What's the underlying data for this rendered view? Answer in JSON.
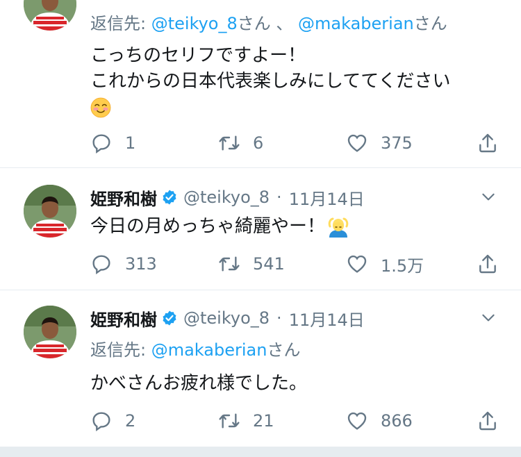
{
  "tweets": [
    {
      "reply_prefix": "返信先: ",
      "mentions": [
        "@teikyo_8",
        "@makaberian"
      ],
      "san": "さん",
      "sep": " 、 ",
      "line1": "こっちのセリフですよー！",
      "line2": "これからの日本代表楽しみにしててください",
      "replies": "1",
      "retweets": "6",
      "likes": "375"
    },
    {
      "name": "姫野和樹",
      "handle": "@teikyo_8",
      "dot": "·",
      "date": "11月14日",
      "text": "今日の月めっちゃ綺麗やー！",
      "replies": "313",
      "retweets": "541",
      "likes": "1.5万"
    },
    {
      "name": "姫野和樹",
      "handle": "@teikyo_8",
      "dot": "·",
      "date": "11月14日",
      "reply_prefix": "返信先: ",
      "mention": "@makaberian",
      "san": "さん",
      "text": "かべさんお疲れ様でした。",
      "replies": "2",
      "retweets": "21",
      "likes": "866"
    }
  ],
  "colors": {
    "link": "#1da1f2",
    "secondary": "#657786",
    "verified": "#1da1f2",
    "divider": "#e6ecf0"
  }
}
